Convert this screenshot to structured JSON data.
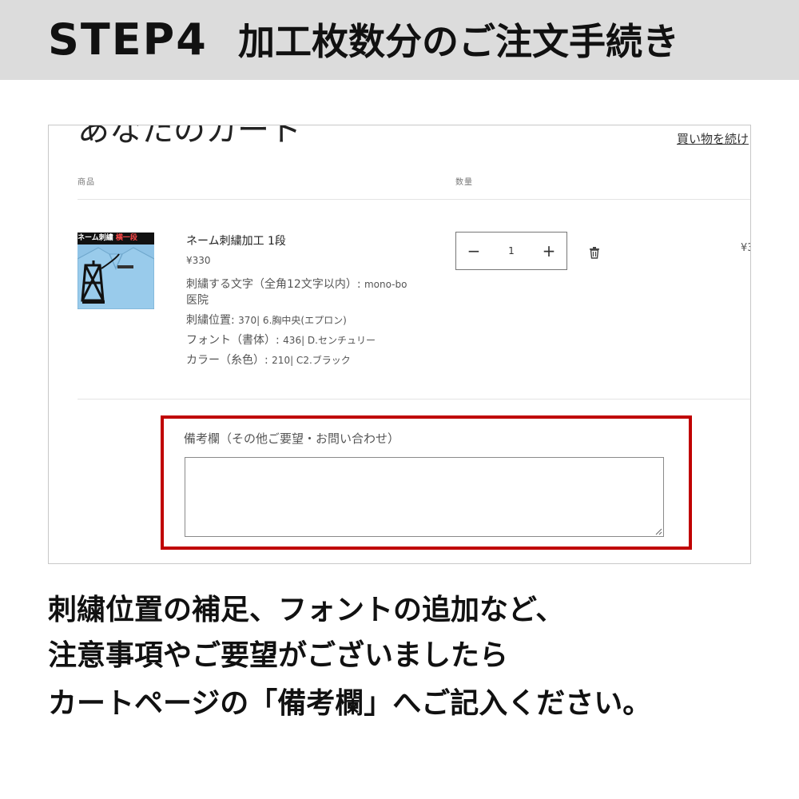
{
  "header": {
    "step_label": "STEP4",
    "step_title": "加工枚数分のご注文手続き"
  },
  "cart": {
    "title": "あなたのカート",
    "continue_shopping": "買い物を続け",
    "columns": {
      "product": "商品",
      "quantity": "数量"
    },
    "item": {
      "thumbnail_banner_left": "ネーム刺繍",
      "thumbnail_banner_right": "横一段",
      "name": "ネーム刺繍加工 1段",
      "price": "¥330",
      "properties": [
        {
          "label": "刺繍する文字（全角12文字以内）: ",
          "value": "mono-bo"
        },
        {
          "label": "医院",
          "value": ""
        },
        {
          "label": "刺繍位置: ",
          "value": "370| 6.胸中央(エプロン)"
        },
        {
          "label": "フォント（書体）: ",
          "value": "436| D.センチュリー"
        },
        {
          "label": "カラー（糸色）: ",
          "value": "210| C2.ブラック"
        }
      ],
      "quantity": "1",
      "line_price": "¥3"
    },
    "quantity_minus": "−",
    "quantity_plus": "+",
    "notes_label": "備考欄（その他ご要望・お問い合わせ）",
    "notes_value": ""
  },
  "instructions": [
    "刺繍位置の補足、フォントの追加など、",
    "注意事項やご要望がございましたら",
    "カートページの「備考欄」へご記入ください。"
  ],
  "colors": {
    "header_bg": "#dcdcdc",
    "highlight": "#c00000",
    "thumbnail_bg": "#8fc3e6"
  }
}
